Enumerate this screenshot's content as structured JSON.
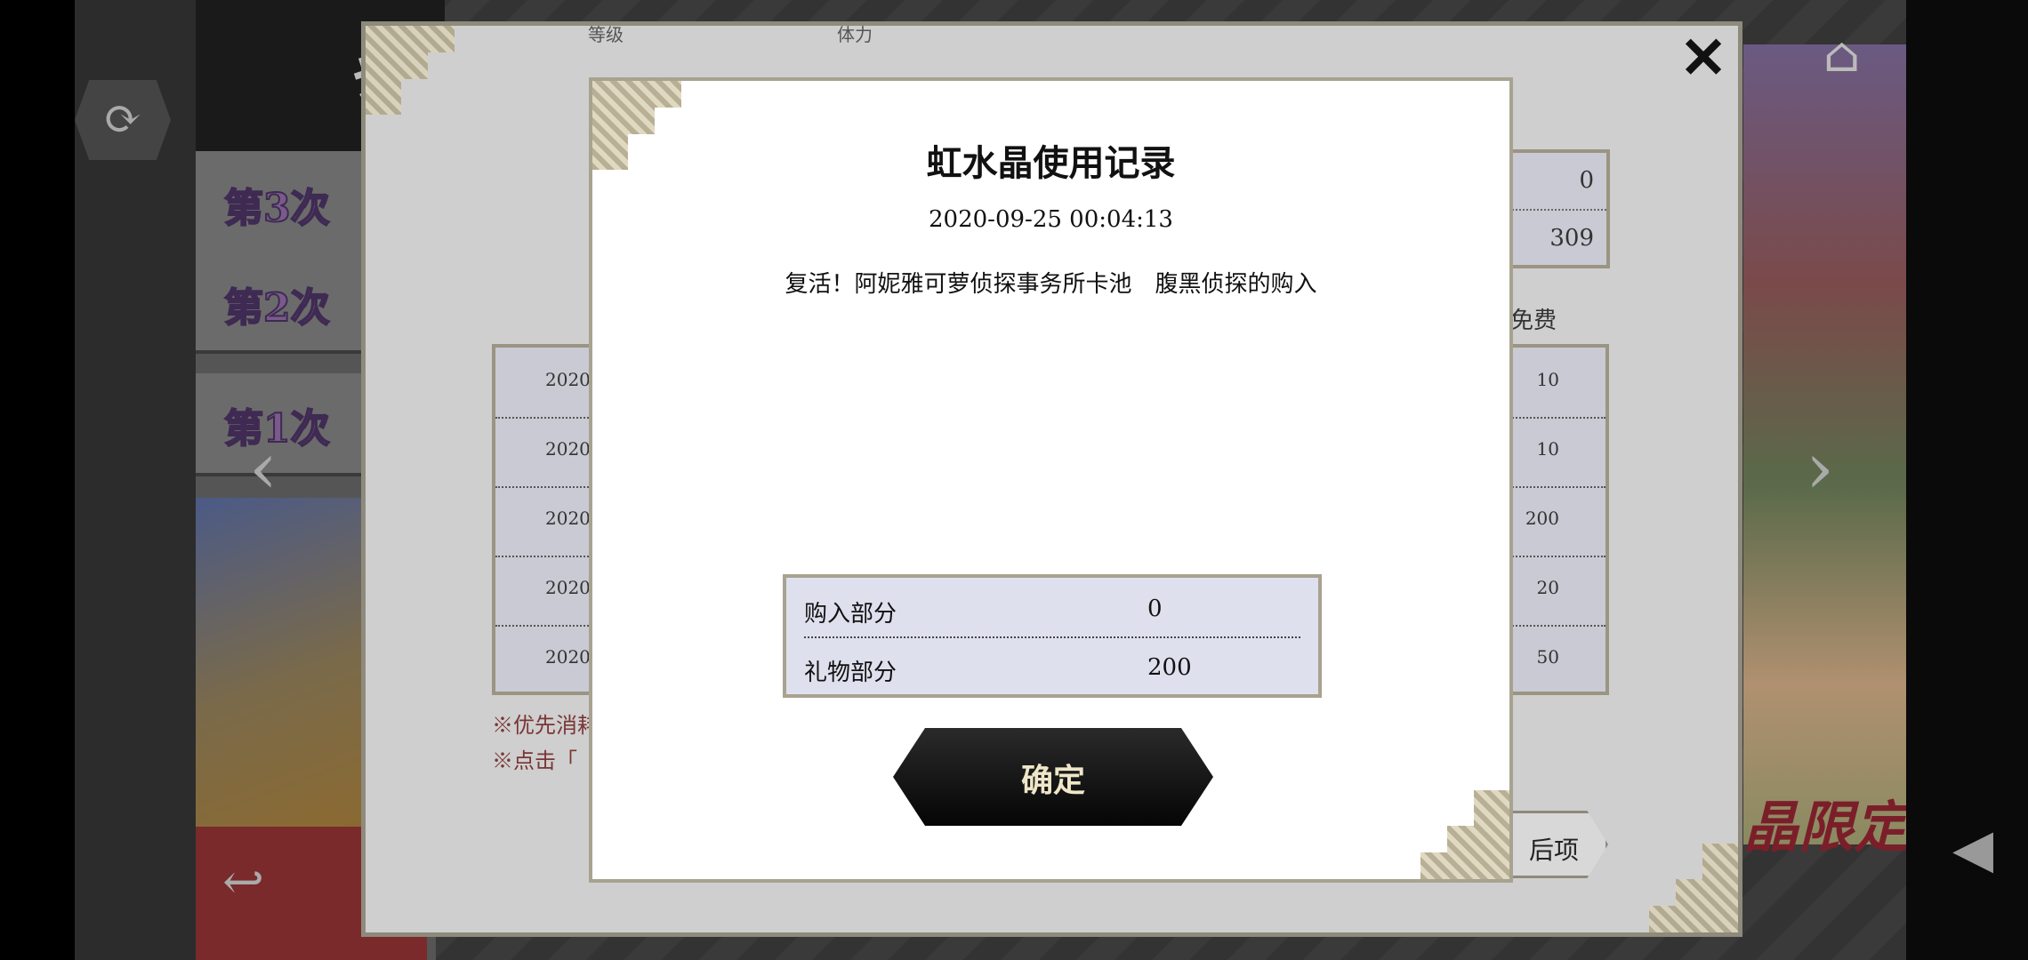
{
  "background": {
    "header_labels": [
      "等级",
      "体力"
    ],
    "lottery_title": "抽卡",
    "lottery_tabs": [
      "第3次",
      "第2次",
      "第1次"
    ],
    "free_label": "免费",
    "stats": [
      "0",
      "309"
    ],
    "history_rows": [
      {
        "date": "2020-",
        "value": "10"
      },
      {
        "date": "2020-",
        "value": "10"
      },
      {
        "date": "2020-",
        "value": "200"
      },
      {
        "date": "2020-",
        "value": "20"
      },
      {
        "date": "2020-",
        "value": "50"
      }
    ],
    "notes": [
      "※优先消耗",
      "※点击「"
    ],
    "next_button": "后项",
    "banner_text": "晶限定！",
    "icons": {
      "refresh": "refresh-icon",
      "home": "home-icon",
      "prev": "chevron-left-icon",
      "next": "chevron-right-icon",
      "back": "back-arrow-icon",
      "speaker": "speaker-icon",
      "close": "close-icon"
    }
  },
  "dialog": {
    "title": "虹水晶使用记录",
    "timestamp": "2020-09-25 00:04:13",
    "description": "复活！阿妮雅可萝侦探事务所卡池　腹黑侦探的购入",
    "breakdown": [
      {
        "label": "购入部分",
        "value": "0"
      },
      {
        "label": "礼物部分",
        "value": "200"
      }
    ],
    "confirm_label": "确定"
  }
}
